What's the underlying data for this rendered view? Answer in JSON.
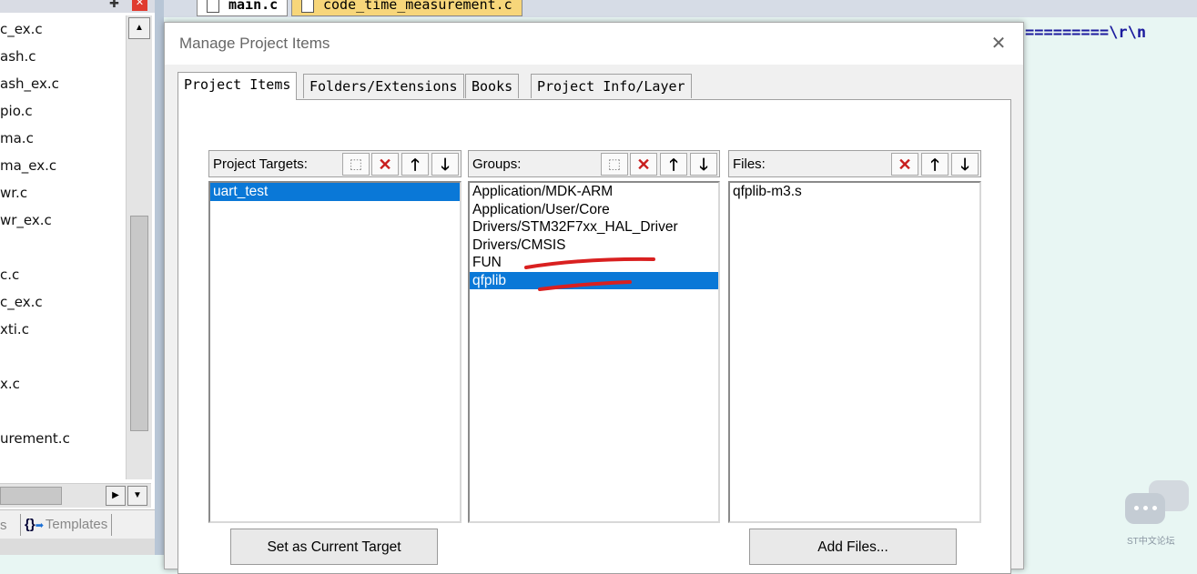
{
  "left_panel": {
    "pin_icon": "pin-icon",
    "close_icon": "close-icon",
    "tree_items": [
      "c_ex.c",
      "ash.c",
      "ash_ex.c",
      "pio.c",
      "ma.c",
      "ma_ex.c",
      "wr.c",
      "wr_ex.c",
      "",
      "c.c",
      "c_ex.c",
      "xti.c",
      "",
      "x.c",
      "",
      "urement.c"
    ],
    "bottom_tabs": {
      "books_fragment": "s",
      "templates_icon": "{}",
      "templates_label": "Templates"
    }
  },
  "editor": {
    "tabs": [
      {
        "label": "main.c",
        "active": true
      },
      {
        "label": "code_time_measurement.c",
        "active": false
      }
    ],
    "code_line_fragment": "=========\\r\\n"
  },
  "dialog": {
    "title": "Manage Project Items",
    "close_label": "✕",
    "tabs": [
      "Project Items",
      "Folders/Extensions",
      "Books",
      "Project Info/Layer"
    ],
    "active_tab": "Project Items",
    "targets": {
      "label": "Project Targets:",
      "items": [
        "uart_test"
      ],
      "selected": "uart_test"
    },
    "groups": {
      "label": "Groups:",
      "items": [
        "Application/MDK-ARM",
        "Application/User/Core",
        "Drivers/STM32F7xx_HAL_Driver",
        "Drivers/CMSIS",
        "FUN",
        "qfplib"
      ],
      "selected": "qfplib"
    },
    "files": {
      "label": "Files:",
      "items": [
        "qfplib-m3.s"
      ]
    },
    "buttons": {
      "set_target": "Set as Current Target",
      "add_files": "Add Files..."
    }
  },
  "watermark": {
    "text": "ST中文论坛"
  },
  "colors": {
    "selection": "#0a78d7",
    "annotation": "#d92020",
    "delete_icon": "#c81e1e"
  }
}
